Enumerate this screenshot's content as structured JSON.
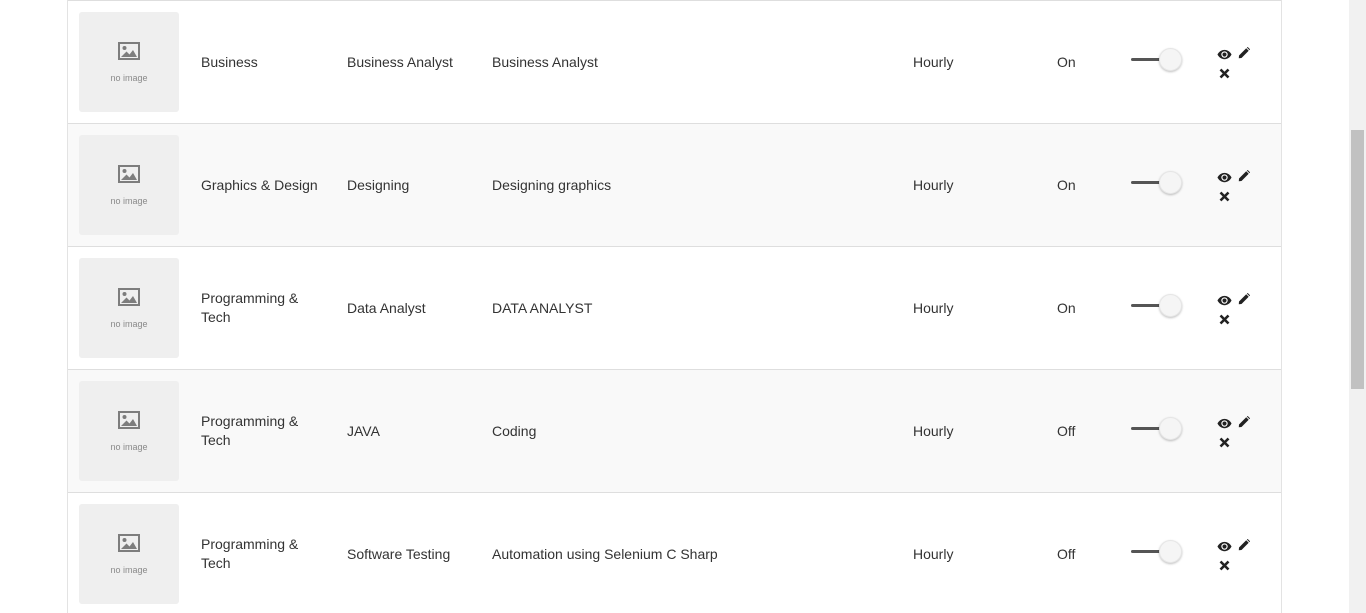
{
  "no_image_label": "no image",
  "rows": [
    {
      "category": "Business",
      "sub_category": "Business Analyst",
      "title": "Business Analyst",
      "type": "Hourly",
      "status": "On"
    },
    {
      "category": "Graphics & Design",
      "sub_category": "Designing",
      "title": "Designing graphics",
      "type": "Hourly",
      "status": "On"
    },
    {
      "category": "Programming & Tech",
      "sub_category": "Data Analyst",
      "title": "DATA ANALYST",
      "type": "Hourly",
      "status": "On"
    },
    {
      "category": "Programming & Tech",
      "sub_category": "JAVA",
      "title": "Coding",
      "type": "Hourly",
      "status": "Off"
    },
    {
      "category": "Programming & Tech",
      "sub_category": "Software Testing",
      "title": "Automation using Selenium C Sharp",
      "type": "Hourly",
      "status": "Off"
    }
  ],
  "icons": {
    "view": "eye-icon",
    "edit": "pencil-icon",
    "delete": "close-icon",
    "placeholder": "image-placeholder-icon"
  },
  "colors": {
    "row_alt_bg": "#f9f9f9",
    "border": "#dedede",
    "text": "#333333",
    "placeholder_bg": "#efefef"
  }
}
